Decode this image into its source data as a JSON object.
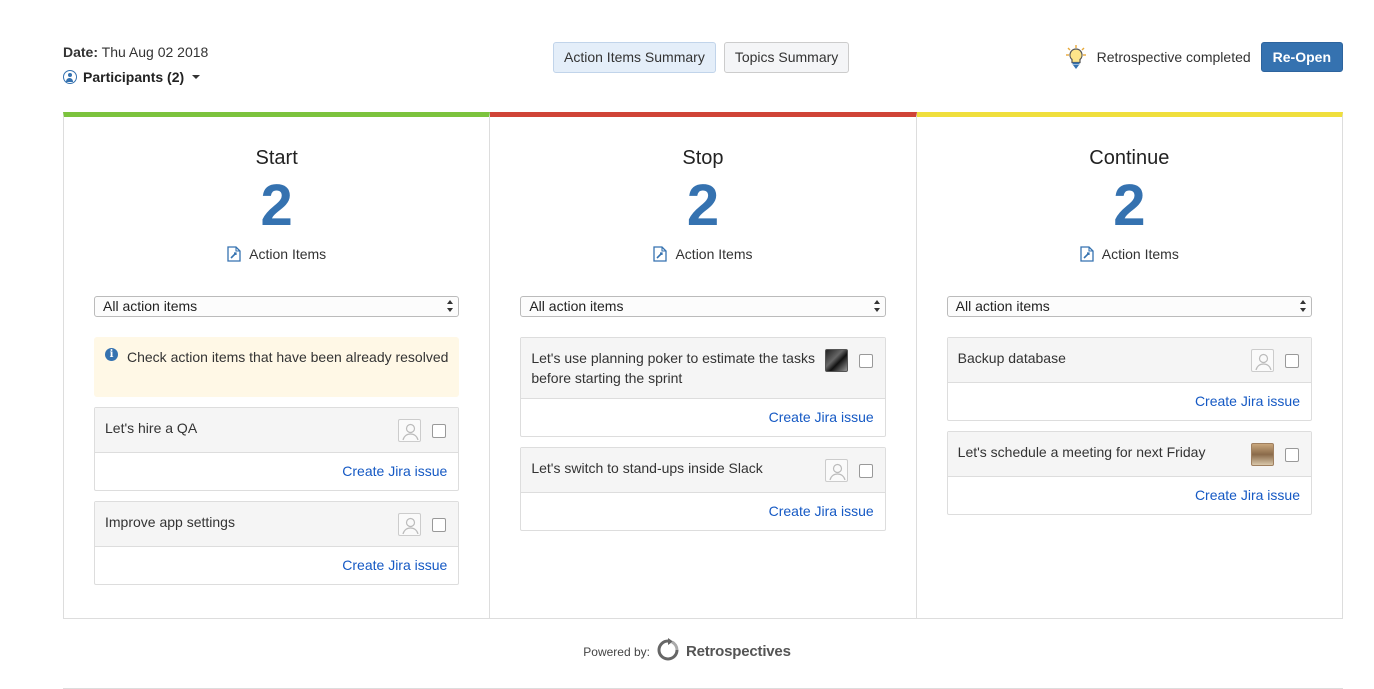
{
  "header": {
    "date_label": "Date:",
    "date_value": "Thu Aug 02 2018",
    "participants_label": "Participants (2)",
    "summary_buttons": [
      "Action Items Summary",
      "Topics Summary"
    ],
    "status_text": "Retrospective completed",
    "reopen_label": "Re-Open"
  },
  "columns": [
    {
      "title": "Start",
      "count": "2",
      "subtitle": "Action Items",
      "filter": "All action items",
      "info": "Check action items that have been already resolved",
      "items": [
        {
          "text": "Let's hire a QA",
          "link": "Create Jira issue"
        },
        {
          "text": "Improve app settings",
          "link": "Create Jira issue"
        }
      ]
    },
    {
      "title": "Stop",
      "count": "2",
      "subtitle": "Action Items",
      "filter": "All action items",
      "items": [
        {
          "text": "Let's use planning poker to estimate the tasks before starting the sprint",
          "link": "Create Jira issue"
        },
        {
          "text": "Let's switch to stand-ups inside Slack",
          "link": "Create Jira issue"
        }
      ]
    },
    {
      "title": "Continue",
      "count": "2",
      "subtitle": "Action Items",
      "filter": "All action items",
      "items": [
        {
          "text": "Backup database",
          "link": "Create Jira issue"
        },
        {
          "text": "Let's schedule a meeting for next Friday",
          "link": "Create Jira issue"
        }
      ]
    }
  ],
  "footer": {
    "powered_by": "Powered by:",
    "brand": "Retrospectives"
  },
  "colors": {
    "accent": "#3572b0",
    "start": "#7cc33d",
    "stop": "#d04437",
    "continue": "#f0df3c",
    "link": "#1559c4"
  }
}
